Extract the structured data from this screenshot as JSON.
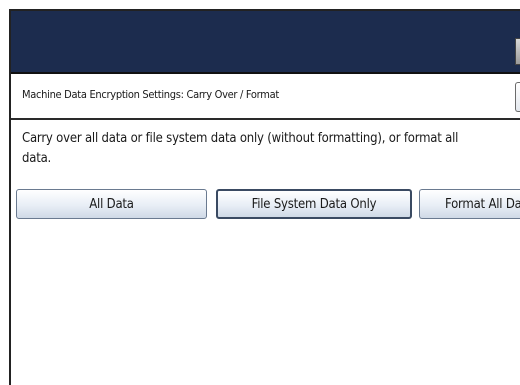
{
  "screen": {
    "title": "Machine Data Encryption Settings: Carry Over / Format",
    "message": "Carry over all data or file system data only (without formatting), or format all\ndata."
  },
  "buttons": {
    "all_data": "All Data",
    "file_system_data_only": "File System Data Only",
    "format": "Format All Data"
  }
}
